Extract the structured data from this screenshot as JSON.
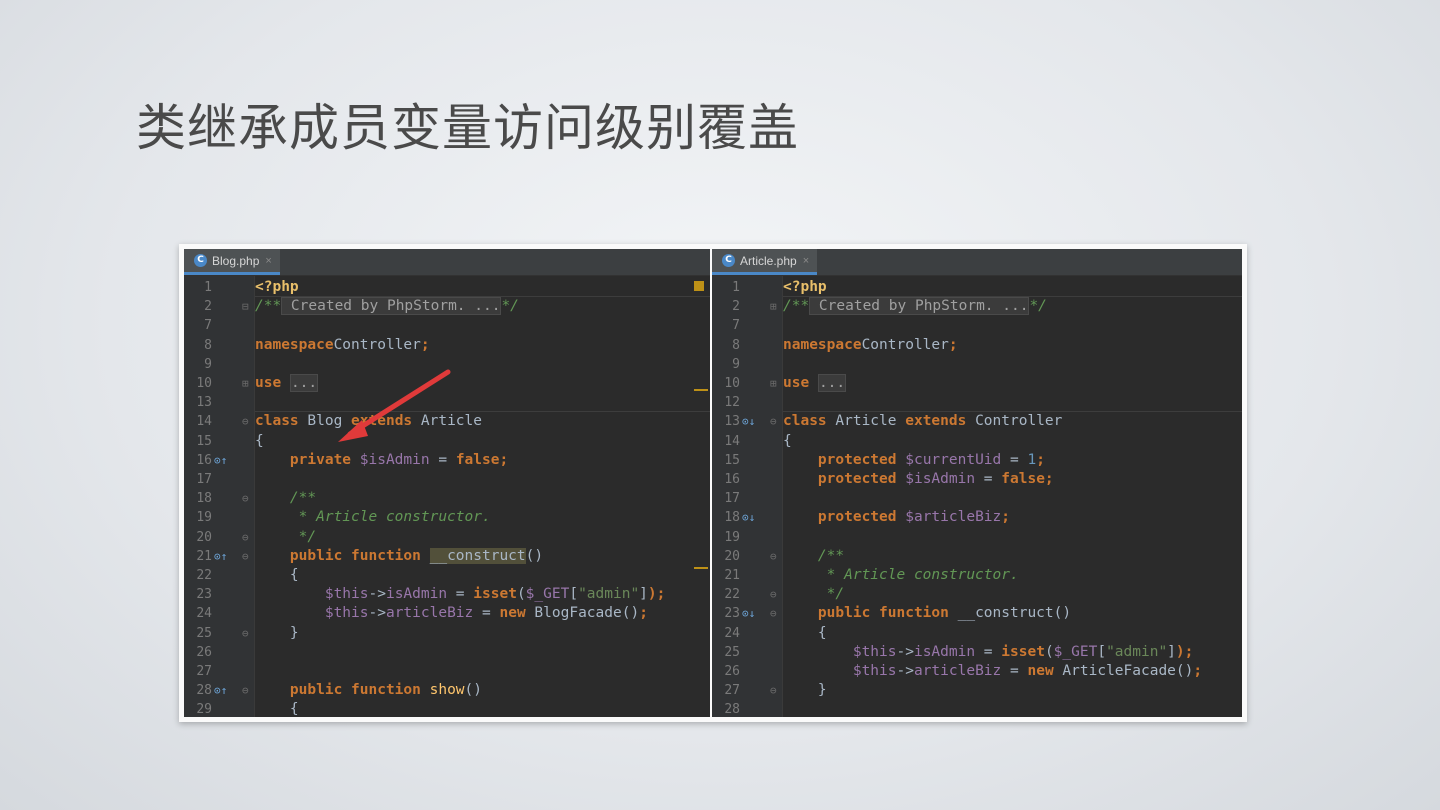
{
  "slide": {
    "title": "类继承成员变量访问级别覆盖"
  },
  "left": {
    "tab": {
      "icon": "C",
      "label": "Blog.php",
      "close": "×"
    },
    "lines": [
      {
        "n": "1",
        "parts": [
          [
            "php",
            "<?php"
          ]
        ]
      },
      {
        "n": "2",
        "fold": "⊟",
        "parts": [
          [
            "cmt",
            "/**"
          ],
          [
            "fold-inline",
            " Created by PhpStorm. ..."
          ],
          [
            "cmt",
            "*/"
          ]
        ]
      },
      {
        "n": "7",
        "parts": []
      },
      {
        "n": "8",
        "parts": [
          [
            "kw",
            "namespace"
          ],
          [
            "",
            "Controller"
          ],
          [
            "kw",
            ";"
          ]
        ]
      },
      {
        "n": "9",
        "parts": []
      },
      {
        "n": "10",
        "fold": "⊞",
        "parts": [
          [
            "kw",
            "use"
          ],
          [
            "",
            " "
          ],
          [
            "fold-inline",
            "..."
          ]
        ]
      },
      {
        "n": "13",
        "parts": []
      },
      {
        "n": "14",
        "fold": "⊖",
        "parts": [
          [
            "kw",
            "class"
          ],
          [
            "",
            " Blog "
          ],
          [
            "kw",
            "extends"
          ],
          [
            "",
            " Article"
          ]
        ]
      },
      {
        "n": "15",
        "parts": [
          [
            "",
            "{"
          ]
        ]
      },
      {
        "n": "16",
        "mark": "⊙↑",
        "parts": [
          [
            "",
            "    "
          ],
          [
            "kw",
            "private"
          ],
          [
            "",
            " "
          ],
          [
            "var",
            "$isAdmin"
          ],
          [
            "",
            " = "
          ],
          [
            "kw",
            "false;"
          ]
        ]
      },
      {
        "n": "17",
        "parts": []
      },
      {
        "n": "18",
        "fold": "⊖",
        "parts": [
          [
            "",
            "    "
          ],
          [
            "cmt",
            "/**"
          ]
        ]
      },
      {
        "n": "19",
        "parts": [
          [
            "",
            "     "
          ],
          [
            "cmt",
            "* Article constructor."
          ]
        ]
      },
      {
        "n": "20",
        "fold": "⊖",
        "parts": [
          [
            "",
            "     "
          ],
          [
            "cmt",
            "*/"
          ]
        ]
      },
      {
        "n": "21",
        "mark": "⊙↑",
        "fold": "⊖",
        "parts": [
          [
            "",
            "    "
          ],
          [
            "kw",
            "public function"
          ],
          [
            "",
            " "
          ],
          [
            "hl",
            "__construct"
          ],
          [
            "",
            "()"
          ]
        ]
      },
      {
        "n": "22",
        "parts": [
          [
            "",
            "    {"
          ]
        ]
      },
      {
        "n": "23",
        "parts": [
          [
            "",
            "        "
          ],
          [
            "var",
            "$this"
          ],
          [
            "",
            "->"
          ],
          [
            "var",
            "isAdmin"
          ],
          [
            "",
            " = "
          ],
          [
            "kw",
            "isset"
          ],
          [
            "",
            "("
          ],
          [
            "var",
            "$_GET"
          ],
          [
            "",
            "["
          ],
          [
            "str",
            "\"admin\""
          ],
          [
            "",
            "]"
          ],
          [
            "kw",
            ");"
          ]
        ]
      },
      {
        "n": "24",
        "parts": [
          [
            "",
            "        "
          ],
          [
            "var",
            "$this"
          ],
          [
            "",
            "->"
          ],
          [
            "var",
            "articleBiz"
          ],
          [
            "",
            " = "
          ],
          [
            "kw",
            "new"
          ],
          [
            "",
            " BlogFacade()"
          ],
          [
            "kw",
            ";"
          ]
        ]
      },
      {
        "n": "25",
        "fold": "⊖",
        "parts": [
          [
            "",
            "    }"
          ]
        ]
      },
      {
        "n": "26",
        "parts": []
      },
      {
        "n": "27",
        "parts": []
      },
      {
        "n": "28",
        "mark": "⊙↑",
        "fold": "⊖",
        "parts": [
          [
            "",
            "    "
          ],
          [
            "kw",
            "public function"
          ],
          [
            "",
            " "
          ],
          [
            "fn",
            "show"
          ],
          [
            "",
            "()"
          ]
        ]
      },
      {
        "n": "29",
        "parts": [
          [
            "",
            "    {"
          ]
        ]
      }
    ]
  },
  "right": {
    "tab": {
      "icon": "C",
      "label": "Article.php",
      "close": "×"
    },
    "lines": [
      {
        "n": "1",
        "parts": [
          [
            "php",
            "<?php"
          ]
        ]
      },
      {
        "n": "2",
        "fold": "⊞",
        "parts": [
          [
            "cmt",
            "/**"
          ],
          [
            "fold-inline",
            " Created by PhpStorm. ..."
          ],
          [
            "cmt",
            "*/"
          ]
        ]
      },
      {
        "n": "7",
        "parts": []
      },
      {
        "n": "8",
        "parts": [
          [
            "kw",
            "namespace"
          ],
          [
            "",
            "Controller"
          ],
          [
            "kw",
            ";"
          ]
        ]
      },
      {
        "n": "9",
        "parts": []
      },
      {
        "n": "10",
        "fold": "⊞",
        "parts": [
          [
            "kw",
            "use"
          ],
          [
            "",
            " "
          ],
          [
            "fold-inline",
            "..."
          ]
        ]
      },
      {
        "n": "12",
        "parts": []
      },
      {
        "n": "13",
        "mark": "⊙↓",
        "fold": "⊖",
        "parts": [
          [
            "kw",
            "class"
          ],
          [
            "",
            " Article "
          ],
          [
            "kw",
            "extends"
          ],
          [
            "",
            " Controller"
          ]
        ]
      },
      {
        "n": "14",
        "parts": [
          [
            "",
            "{"
          ]
        ]
      },
      {
        "n": "15",
        "parts": [
          [
            "",
            "    "
          ],
          [
            "kw",
            "protected"
          ],
          [
            "",
            " "
          ],
          [
            "var",
            "$currentUid"
          ],
          [
            "",
            " = "
          ],
          [
            "num",
            "1"
          ],
          [
            "kw",
            ";"
          ]
        ]
      },
      {
        "n": "16",
        "parts": [
          [
            "",
            "    "
          ],
          [
            "kw",
            "protected"
          ],
          [
            "",
            " "
          ],
          [
            "var",
            "$isAdmin"
          ],
          [
            "",
            " = "
          ],
          [
            "kw",
            "false;"
          ]
        ]
      },
      {
        "n": "17",
        "parts": []
      },
      {
        "n": "18",
        "mark": "⊙↓",
        "parts": [
          [
            "",
            "    "
          ],
          [
            "kw",
            "protected"
          ],
          [
            "",
            " "
          ],
          [
            "var",
            "$articleBiz"
          ],
          [
            "kw",
            ";"
          ]
        ]
      },
      {
        "n": "19",
        "parts": []
      },
      {
        "n": "20",
        "fold": "⊖",
        "parts": [
          [
            "",
            "    "
          ],
          [
            "cmt",
            "/**"
          ]
        ]
      },
      {
        "n": "21",
        "parts": [
          [
            "",
            "     "
          ],
          [
            "cmt",
            "* Article constructor."
          ]
        ]
      },
      {
        "n": "22",
        "fold": "⊖",
        "parts": [
          [
            "",
            "     "
          ],
          [
            "cmt",
            "*/"
          ]
        ]
      },
      {
        "n": "23",
        "mark": "⊙↓",
        "fold": "⊖",
        "parts": [
          [
            "",
            "    "
          ],
          [
            "kw",
            "public function"
          ],
          [
            "",
            " __construct()"
          ]
        ]
      },
      {
        "n": "24",
        "parts": [
          [
            "",
            "    {"
          ]
        ]
      },
      {
        "n": "25",
        "parts": [
          [
            "",
            "        "
          ],
          [
            "var",
            "$this"
          ],
          [
            "",
            "->"
          ],
          [
            "var",
            "isAdmin"
          ],
          [
            "",
            " = "
          ],
          [
            "kw",
            "isset"
          ],
          [
            "",
            "("
          ],
          [
            "var",
            "$_GET"
          ],
          [
            "",
            "["
          ],
          [
            "str",
            "\"admin\""
          ],
          [
            "",
            "]"
          ],
          [
            "kw",
            ");"
          ]
        ]
      },
      {
        "n": "26",
        "parts": [
          [
            "",
            "        "
          ],
          [
            "var",
            "$this"
          ],
          [
            "",
            "->"
          ],
          [
            "var",
            "articleBiz"
          ],
          [
            "",
            " = "
          ],
          [
            "kw",
            "new"
          ],
          [
            "",
            " ArticleFacade()"
          ],
          [
            "kw",
            ";"
          ]
        ]
      },
      {
        "n": "27",
        "fold": "⊖",
        "parts": [
          [
            "",
            "    }"
          ]
        ]
      },
      {
        "n": "28",
        "parts": []
      }
    ]
  },
  "colors": {
    "arrow": "#e03a3a",
    "tab_accent": "#4a88c7",
    "editor_bg": "#2b2b2b"
  }
}
